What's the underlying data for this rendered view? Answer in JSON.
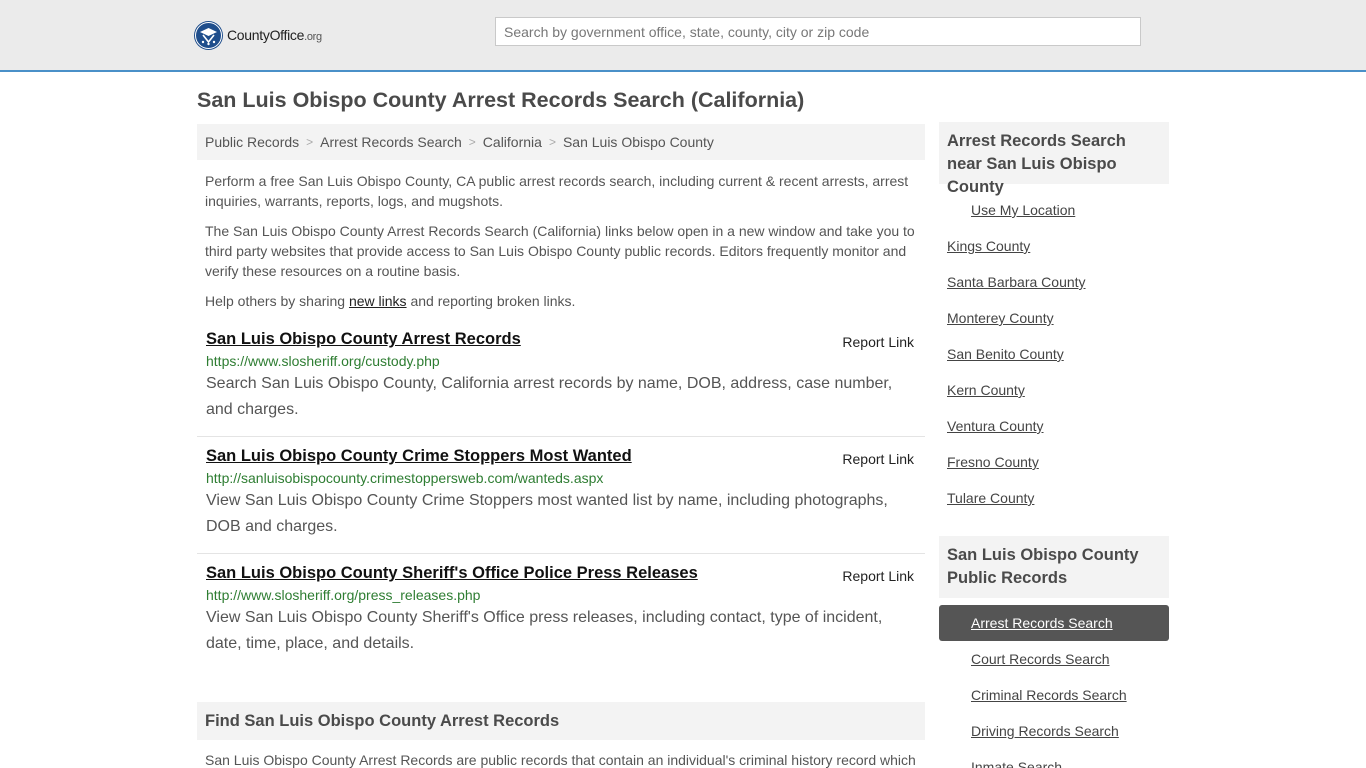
{
  "header": {
    "logo": {
      "county": "County",
      "office": "Office",
      "org": ".org"
    },
    "search_placeholder": "Search by government office, state, county, city or zip code"
  },
  "page_title": "San Luis Obispo County Arrest Records Search (California)",
  "breadcrumb": [
    {
      "label": "Public Records"
    },
    {
      "label": "Arrest Records Search"
    },
    {
      "label": "California"
    },
    {
      "label": "San Luis Obispo County"
    }
  ],
  "intro": {
    "p1": "Perform a free San Luis Obispo County, CA public arrest records search, including current & recent arrests, arrest inquiries, warrants, reports, logs, and mugshots.",
    "p2": "The San Luis Obispo County Arrest Records Search (California) links below open in a new window and take you to third party websites that provide access to San Luis Obispo County public records. Editors frequently monitor and verify these resources on a routine basis.",
    "p3_before": "Help others by sharing ",
    "p3_link": "new links",
    "p3_after": " and reporting broken links."
  },
  "records": [
    {
      "title": "San Luis Obispo County Arrest Records",
      "report": "Report Link",
      "url": "https://www.slosheriff.org/custody.php",
      "desc": "Search San Luis Obispo County, California arrest records by name, DOB, address, case number, and charges."
    },
    {
      "title": "San Luis Obispo County Crime Stoppers Most Wanted",
      "report": "Report Link",
      "url": "http://sanluisobispocounty.crimestoppersweb.com/wanteds.aspx",
      "desc": "View San Luis Obispo County Crime Stoppers most wanted list by name, including photographs, DOB and charges."
    },
    {
      "title": "San Luis Obispo County Sheriff's Office Police Press Releases",
      "report": "Report Link",
      "url": "http://www.slosheriff.org/press_releases.php",
      "desc": "View San Luis Obispo County Sheriff's Office press releases, including contact, type of incident, date, time, place, and details."
    }
  ],
  "find": {
    "heading": "Find San Luis Obispo County Arrest Records",
    "text": "San Luis Obispo County Arrest Records are public records that contain an individual's criminal history record which"
  },
  "sidebar": {
    "nearby_heading": "Arrest Records Search near San Luis Obispo County",
    "use_location": "Use My Location",
    "nearby": [
      "Kings County",
      "Santa Barbara County",
      "Monterey County",
      "San Benito County",
      "Kern County",
      "Ventura County",
      "Fresno County",
      "Tulare County"
    ],
    "records_heading": "San Luis Obispo County Public Records",
    "records_links": [
      "Arrest Records Search",
      "Court Records Search",
      "Criminal Records Search",
      "Driving Records Search",
      "Inmate Search"
    ]
  }
}
